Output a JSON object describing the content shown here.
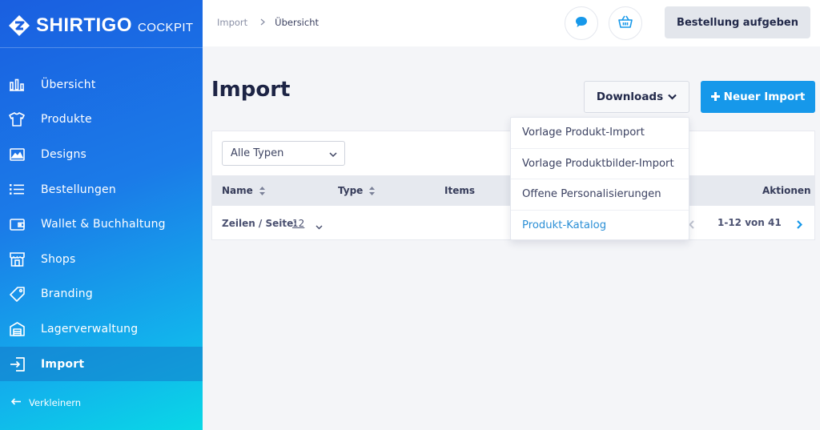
{
  "brand": {
    "name": "SHIRTIGO",
    "sub": "COCKPIT"
  },
  "sidebar": {
    "items": [
      {
        "label": "Übersicht",
        "icon": "bar-chart-icon"
      },
      {
        "label": "Produkte",
        "icon": "tshirt-icon"
      },
      {
        "label": "Designs",
        "icon": "image-icon"
      },
      {
        "label": "Bestellungen",
        "icon": "list-icon"
      },
      {
        "label": "Wallet & Buchhaltung",
        "icon": "wallet-icon"
      },
      {
        "label": "Shops",
        "icon": "store-icon"
      },
      {
        "label": "Branding",
        "icon": "tag-icon"
      },
      {
        "label": "Lagerverwaltung",
        "icon": "warehouse-icon"
      },
      {
        "label": "Import",
        "icon": "import-icon",
        "active": true
      }
    ],
    "collapse_label": "Verkleinern"
  },
  "topbar": {
    "breadcrumb": [
      "Import",
      "Übersicht"
    ],
    "chat_icon": "chat-bubble-icon",
    "cart_icon": "basket-icon",
    "order_button": "Bestellung aufgeben"
  },
  "main": {
    "title": "Import",
    "downloads_label": "Downloads",
    "new_import_label": "Neuer Import",
    "filter_select": "Alle Typen",
    "columns": [
      "Name",
      "Type",
      "Items",
      "Aktionen"
    ],
    "rows_per_page_label": "Zeilen / Seite:",
    "rows_per_page": "12",
    "pagination": "1-12 von 41"
  },
  "dropdown": {
    "items": [
      "Vorlage Produkt-Import",
      "Vorlage Produktbilder-Import",
      "Offene Personalisierungen",
      "Produkt-Katalog"
    ]
  },
  "colors": {
    "accent": "#1698ea",
    "sidebar_top": "#1a5fe0",
    "sidebar_bottom": "#09d8e6",
    "title": "#1d2445"
  }
}
